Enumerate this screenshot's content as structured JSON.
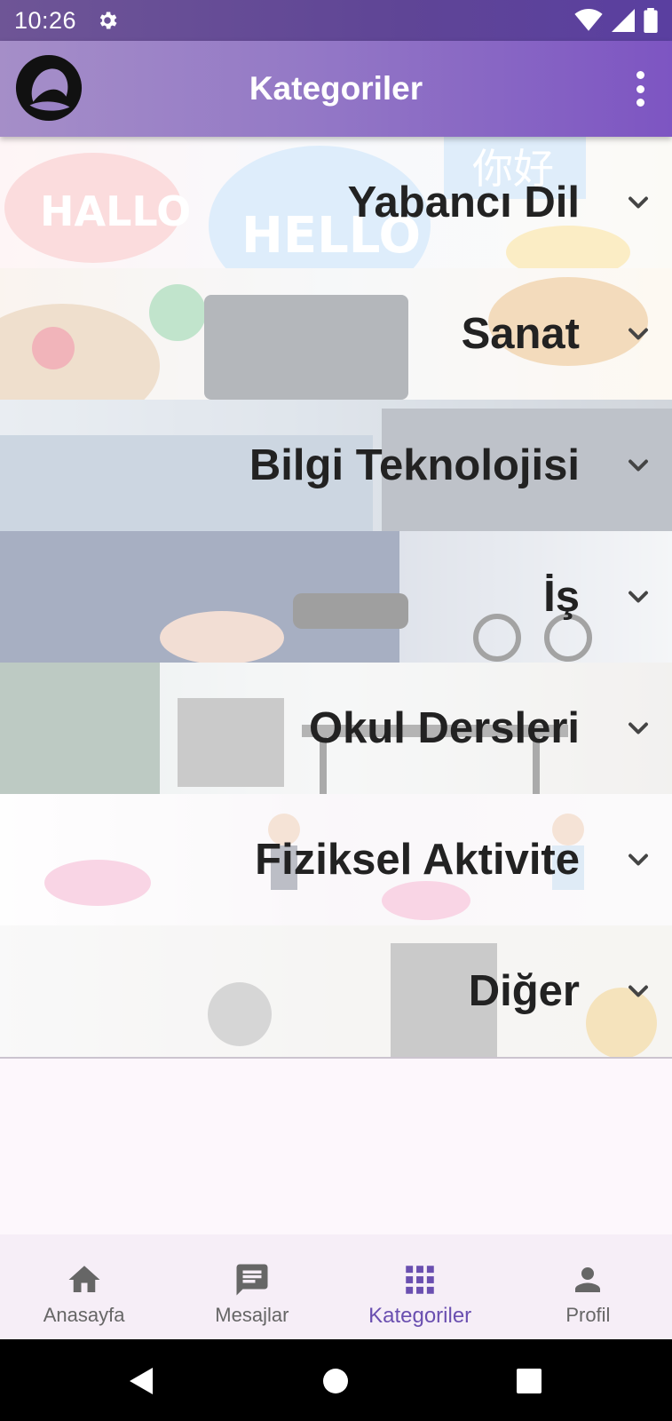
{
  "status_bar": {
    "time": "10:26"
  },
  "app_bar": {
    "title": "Kategoriler"
  },
  "categories": [
    {
      "label": "Yabancı Dil"
    },
    {
      "label": "Sanat"
    },
    {
      "label": "Bilgi Teknolojisi"
    },
    {
      "label": "İş"
    },
    {
      "label": "Okul Dersleri"
    },
    {
      "label": "Fiziksel Aktivite"
    },
    {
      "label": "Diğer"
    }
  ],
  "bottom_nav": {
    "active_color": "#6a4fb0",
    "items": [
      {
        "label": "Anasayfa",
        "icon": "home-icon"
      },
      {
        "label": "Mesajlar",
        "icon": "message-icon"
      },
      {
        "label": "Kategoriler",
        "icon": "grid-icon",
        "active": true
      },
      {
        "label": "Profil",
        "icon": "person-icon"
      }
    ]
  },
  "icons": {
    "status": [
      "gear-icon",
      "wifi-icon",
      "signal-icon",
      "battery-icon"
    ],
    "system_nav": [
      "back-icon",
      "home-circle-icon",
      "recents-icon"
    ]
  }
}
